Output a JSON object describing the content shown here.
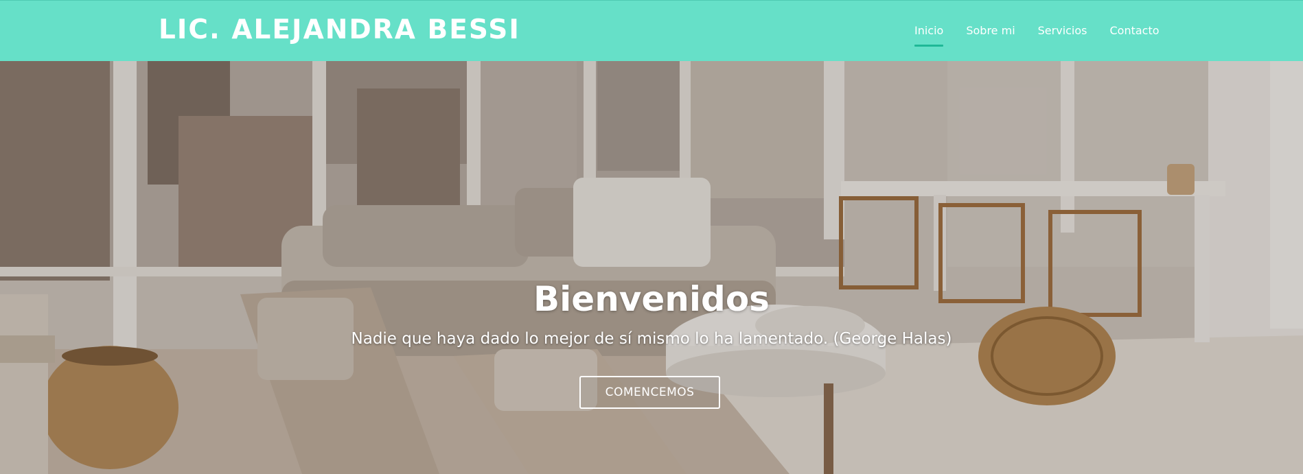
{
  "header": {
    "brand": "LIC. ALEJANDRA BESSI",
    "nav": [
      {
        "label": "Inicio",
        "active": true
      },
      {
        "label": "Sobre mi",
        "active": false
      },
      {
        "label": "Servicios",
        "active": false
      },
      {
        "label": "Contacto",
        "active": false
      }
    ]
  },
  "hero": {
    "title": "Bienvenidos",
    "subtitle": "Nadie que haya dado lo mejor de sí mismo lo ha lamentado. (George Halas)",
    "cta_label": "COMENCEMOS"
  },
  "colors": {
    "navbar_bg": "#66e0c8",
    "nav_active_underline": "#1fb897",
    "text": "#ffffff"
  }
}
